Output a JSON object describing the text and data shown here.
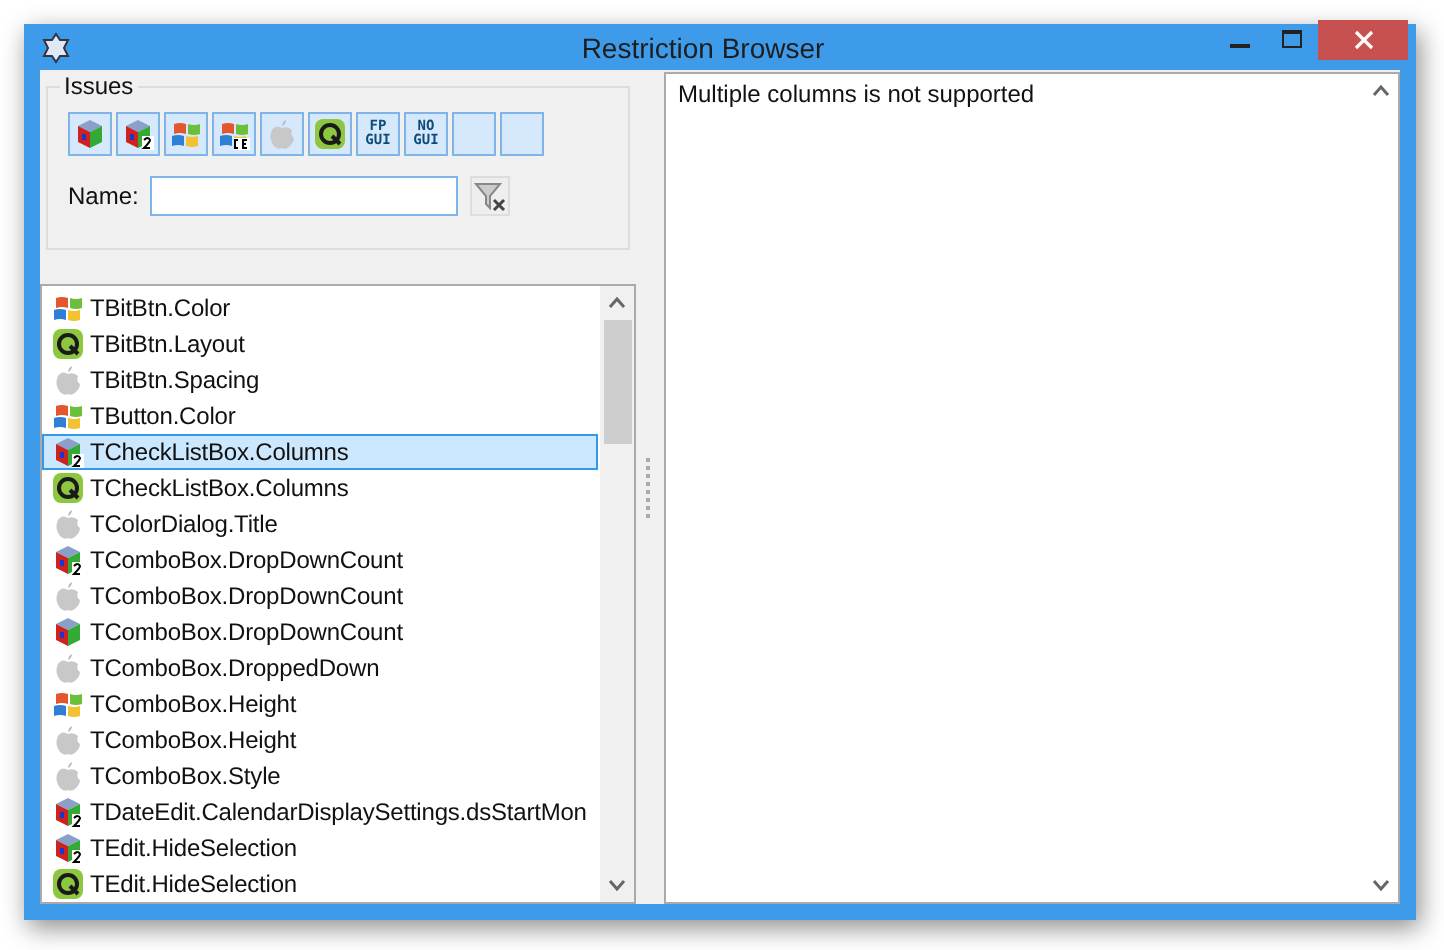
{
  "window": {
    "title": "Restriction Browser"
  },
  "issues": {
    "title": "Issues",
    "buttons": [
      {
        "kind": "gtk",
        "selected": true
      },
      {
        "kind": "gtk2",
        "selected": true
      },
      {
        "kind": "win",
        "selected": true
      },
      {
        "kind": "wince",
        "selected": true
      },
      {
        "kind": "carbon",
        "selected": true
      },
      {
        "kind": "qt",
        "selected": true
      },
      {
        "kind": "text",
        "top": "FP",
        "bottom": "GUI",
        "selected": true
      },
      {
        "kind": "text",
        "top": "NO",
        "bottom": "GUI",
        "selected": true
      },
      {
        "kind": "blank",
        "selected": true
      },
      {
        "kind": "blank",
        "selected": true
      }
    ]
  },
  "name_filter": {
    "label": "Name:"
  },
  "list": [
    {
      "kind": "win",
      "text": "TBitBtn.Color",
      "selected": false
    },
    {
      "kind": "qt",
      "text": "TBitBtn.Layout",
      "selected": false
    },
    {
      "kind": "carbon",
      "text": "TBitBtn.Spacing",
      "selected": false
    },
    {
      "kind": "win",
      "text": "TButton.Color",
      "selected": false
    },
    {
      "kind": "gtk2",
      "text": "TCheckListBox.Columns",
      "selected": true
    },
    {
      "kind": "qt",
      "text": "TCheckListBox.Columns",
      "selected": false
    },
    {
      "kind": "carbon",
      "text": "TColorDialog.Title",
      "selected": false
    },
    {
      "kind": "gtk2",
      "text": "TComboBox.DropDownCount",
      "selected": false
    },
    {
      "kind": "carbon",
      "text": "TComboBox.DropDownCount",
      "selected": false
    },
    {
      "kind": "gtk",
      "text": "TComboBox.DropDownCount",
      "selected": false
    },
    {
      "kind": "carbon",
      "text": "TComboBox.DroppedDown",
      "selected": false
    },
    {
      "kind": "win",
      "text": "TComboBox.Height",
      "selected": false
    },
    {
      "kind": "carbon",
      "text": "TComboBox.Height",
      "selected": false
    },
    {
      "kind": "carbon",
      "text": "TComboBox.Style",
      "selected": false
    },
    {
      "kind": "gtk2",
      "text": "TDateEdit.CalendarDisplaySettings.dsStartMon",
      "selected": false
    },
    {
      "kind": "gtk2",
      "text": "TEdit.HideSelection",
      "selected": false
    },
    {
      "kind": "qt",
      "text": "TEdit.HideSelection",
      "selected": false
    }
  ],
  "description": "Multiple columns is not supported"
}
